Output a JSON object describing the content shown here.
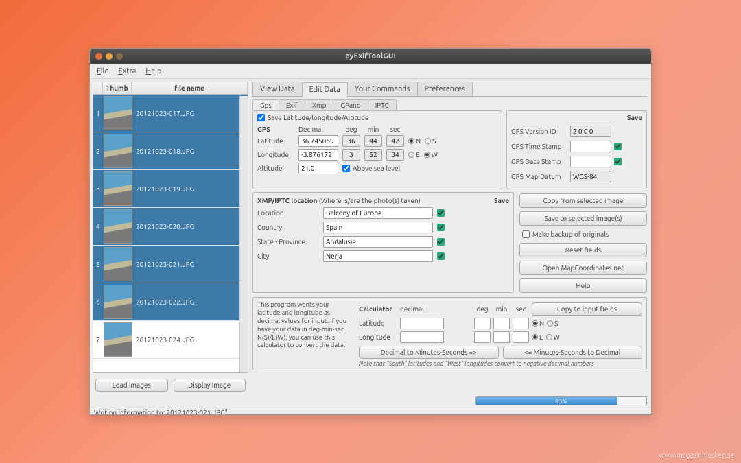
{
  "title": "pyExifToolGUI",
  "menu": {
    "file": "File",
    "extra": "Extra",
    "help": "Help"
  },
  "table": {
    "cols": {
      "thumb": "Thumb",
      "name": "file name"
    },
    "rows": [
      {
        "n": "1",
        "name": "20121023-017.JPG",
        "sel": true
      },
      {
        "n": "2",
        "name": "20121023-018.JPG",
        "sel": true
      },
      {
        "n": "3",
        "name": "20121023-019.JPG",
        "sel": true
      },
      {
        "n": "4",
        "name": "20121023-020.JPG",
        "sel": true
      },
      {
        "n": "5",
        "name": "20121023-021.JPG",
        "sel": true
      },
      {
        "n": "6",
        "name": "20121023-022.JPG",
        "sel": true
      },
      {
        "n": "7",
        "name": "20121023-024.JPG",
        "sel": false
      }
    ]
  },
  "buttons": {
    "load": "Load Images",
    "display": "Display Image"
  },
  "main_tabs": {
    "view": "View Data",
    "edit": "Edit Data",
    "cmds": "Your Commands",
    "prefs": "Preferences"
  },
  "sub_tabs": {
    "gps": "Gps",
    "exif": "Exif",
    "xmp": "Xmp",
    "gpano": "GPano",
    "iptc": "IPTC"
  },
  "gps": {
    "save_lla": "Save Latitude/longitude/Altitude",
    "hdr": "GPS",
    "cols": {
      "dec": "Decimal",
      "deg": "deg",
      "min": "min",
      "sec": "sec"
    },
    "lat": {
      "label": "Latitude",
      "dec": "36.745069",
      "deg": "36",
      "min": "44",
      "sec": "42",
      "n": "N",
      "s": "S"
    },
    "lon": {
      "label": "Longitude",
      "dec": "-3.876172",
      "deg": "3",
      "min": "52",
      "sec": "34",
      "e": "E",
      "w": "W"
    },
    "alt": {
      "label": "Altitude",
      "val": "21.0",
      "above": "Above sea level"
    },
    "save": "Save",
    "ver": {
      "label": "GPS Version ID",
      "val": "2 0 0 0"
    },
    "ts": {
      "label": "GPS Time Stamp",
      "val": ""
    },
    "ds": {
      "label": "GPS Date Stamp",
      "val": ""
    },
    "md": {
      "label": "GPS Map Datum",
      "val": "WGS-84"
    }
  },
  "loc": {
    "hdr": "XMP/IPTC location",
    "sub": "(Where is/are the photo(s) taken)",
    "save": "Save",
    "location": {
      "label": "Location",
      "val": "Balcony of Europe"
    },
    "country": {
      "label": "Country",
      "val": "Spain"
    },
    "state": {
      "label": "State - Province",
      "val": "Andalusie"
    },
    "city": {
      "label": "City",
      "val": "Nerja"
    }
  },
  "side": {
    "copy": "Copy from selected image",
    "savesel": "Save to selected image(s)",
    "backup": "Make backup of originals",
    "reset": "Reset fields",
    "map": "Open MapCoordinates.net",
    "help": "Help"
  },
  "calc": {
    "help": "This program wants your latitude and longitude as decimal values for input. If you have your data in deg-min-sec N(S)/E(W), you can use this calculator to convert the data.",
    "hdr": "Calculator",
    "dec": "decimal",
    "deg": "deg",
    "min": "min",
    "sec": "sec",
    "lat": "Latitude",
    "lon": "Longitude",
    "n": "N",
    "s": "S",
    "e": "E",
    "w": "W",
    "copy": "Copy to input fields",
    "dms": "Decimal to Minutes-Seconds =>",
    "msd": "<= Minutes-Seconds to Decimal",
    "note": "Note that \"South\" latitudes and \"West\" longitudes convert to negative decimal numbers"
  },
  "status": "Writing information to: 20121023-021.JPG\"",
  "progress": "83%",
  "credit": "www.magasinmacken.se"
}
